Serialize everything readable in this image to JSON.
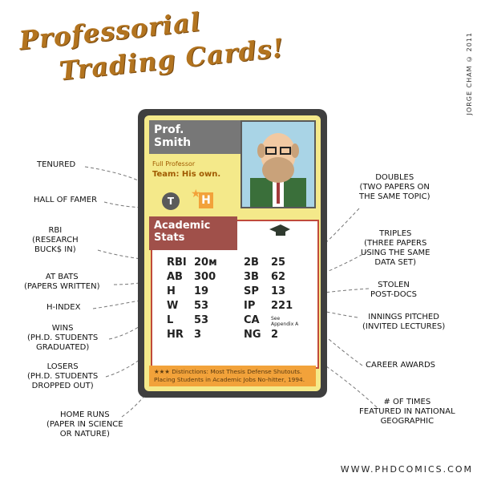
{
  "title": {
    "line1": "Professorial",
    "line2": "Trading Cards!"
  },
  "credit": "JORGE CHAM © 2011",
  "footer": "WWW.PHDCOMICS.COM",
  "card": {
    "name": "Prof.\nSmith",
    "rank": "Full Professor",
    "team": "Team: His own.",
    "badge_t": "T",
    "badge_h": "H",
    "stats_title": "Academic\nStats",
    "stats": [
      {
        "k1": "RBI",
        "v1": "20м",
        "k2": "2B",
        "v2": "25"
      },
      {
        "k1": "AB",
        "v1": "300",
        "k2": "3B",
        "v2": "62"
      },
      {
        "k1": "H",
        "v1": "19",
        "k2": "SP",
        "v2": "13"
      },
      {
        "k1": "W",
        "v1": "53",
        "k2": "IP",
        "v2": "221"
      },
      {
        "k1": "L",
        "v1": "53",
        "k2": "CA",
        "v2": "See\nAppendix A"
      },
      {
        "k1": "HR",
        "v1": "3",
        "k2": "NG",
        "v2": "2"
      }
    ],
    "distinctions": "★★★ Distinctions: Most Thesis Defense Shutouts.\nPlacing Students in Academic Jobs No-hitter, 1994."
  },
  "labels": {
    "tenured": "TENURED",
    "hall": "HALL OF FAMER",
    "rbi": "RBI\n(RESEARCH\nBUCK$ IN)",
    "atbats": "AT BATS\n(PAPERS WRITTEN)",
    "hindex": "H-INDEX",
    "wins": "WINS\n(PH.D. STUDENTS\nGRADUATED)",
    "losers": "LOSERS\n(PH.D. STUDENTS\nDROPPED OUT)",
    "homeruns": "HOME RUNS\n(PAPER IN SCIENCE\nOR NATURE)",
    "doubles": "DOUBLES\n(TWO PAPERS ON\nTHE SAME TOPIC)",
    "triples": "TRIPLES\n(THREE PAPERS\nUSING THE SAME\nDATA SET)",
    "stolen": "STOLEN\nPOST-DOCS",
    "innings": "INNINGS PITCHED\n(INVITED LECTURES)",
    "career": "CAREER AWARDS",
    "ng": "# OF TIMES\nFEATURED IN NATIONAL\nGEOGRAPHIC"
  }
}
